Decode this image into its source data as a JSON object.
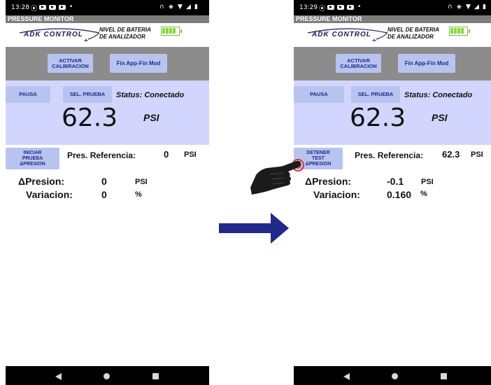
{
  "left_screen": {
    "status_bar": {
      "time": "13:28"
    },
    "app_title": "PRESSURE MONITOR",
    "logo_text": "ADK CONTROL",
    "battery_label_line1": "NIVEL DE BATERIA",
    "battery_label_line2": "DE ANALIZADOR",
    "buttons": {
      "activar_line1": "ACTIVAR",
      "activar_line2": "CALIBRACION",
      "fin_app": "Fin App-Fin Mod",
      "pausa": "PAUSA",
      "sel_prueba": "SEL. PRUEBA",
      "test_line1": "INICIAR",
      "test_line2": "PRUEBA",
      "test_line3": "ΔPRESION"
    },
    "status": "Status: Conectado",
    "pressure_value": "62.3",
    "pressure_unit": "PSI",
    "reference_label": "Pres. Referencia:",
    "reference_value": "0",
    "reference_unit": "PSI",
    "delta_label": "ΔPresion:",
    "delta_value": "0",
    "delta_unit": "PSI",
    "variacion_label": "Variacion:",
    "variacion_value": "0",
    "variacion_unit": "%"
  },
  "right_screen": {
    "status_bar": {
      "time": "13:29"
    },
    "app_title": "PRESSURE MONITOR",
    "logo_text": "ADK CONTROL",
    "battery_label_line1": "NIVEL DE BATERIA",
    "battery_label_line2": "DE ANALIZADOR",
    "buttons": {
      "activar_line1": "ACTIVAR",
      "activar_line2": "CALIBRACION",
      "fin_app": "Fin App-Fin Mod",
      "pausa": "PAUSA",
      "sel_prueba": "SEL. PRUEBA",
      "test_line1": "DETENER",
      "test_line2": "TEST",
      "test_line3": "ΔPRESION"
    },
    "status": "Status: Conectado",
    "pressure_value": "62.3",
    "pressure_unit": "PSI",
    "reference_label": "Pres. Referencia:",
    "reference_value": "62.3",
    "reference_unit": "PSI",
    "delta_label": "ΔPresion:",
    "delta_value": "-0.1",
    "delta_unit": "PSI",
    "variacion_label": "Variacion:",
    "variacion_value": "0.160",
    "variacion_unit": "%"
  },
  "colors": {
    "panel": "#d2d6ff",
    "button": "#b8c4f0",
    "header_gray": "#8c8c8c",
    "arrow": "#1f2a8c",
    "battery": "#8bd63b"
  },
  "icons": [
    "arrow-right-icon",
    "pointing-hand-icon",
    "battery-icon",
    "nav-back-icon",
    "nav-home-icon",
    "nav-recent-icon"
  ]
}
